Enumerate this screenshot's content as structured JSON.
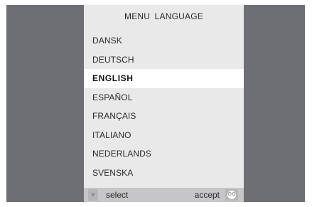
{
  "menu": {
    "title": "MENU  LANGUAGE",
    "selected_index": 2,
    "languages": [
      "DANSK",
      "DEUTSCH",
      "ENGLISH",
      "ESPAÑOL",
      "FRANÇAIS",
      "ITALIANO",
      "NEDERLANDS",
      "SVENSKA"
    ]
  },
  "footer": {
    "down_icon": "▼",
    "select_label": "select",
    "accept_label": "accept",
    "go_label": "GO"
  },
  "colors": {
    "screen_background": "#6e6f73",
    "panel_background": "#e9e9ea",
    "selected_row": "#ffffff",
    "footer_bar": "#c6c6c8"
  }
}
